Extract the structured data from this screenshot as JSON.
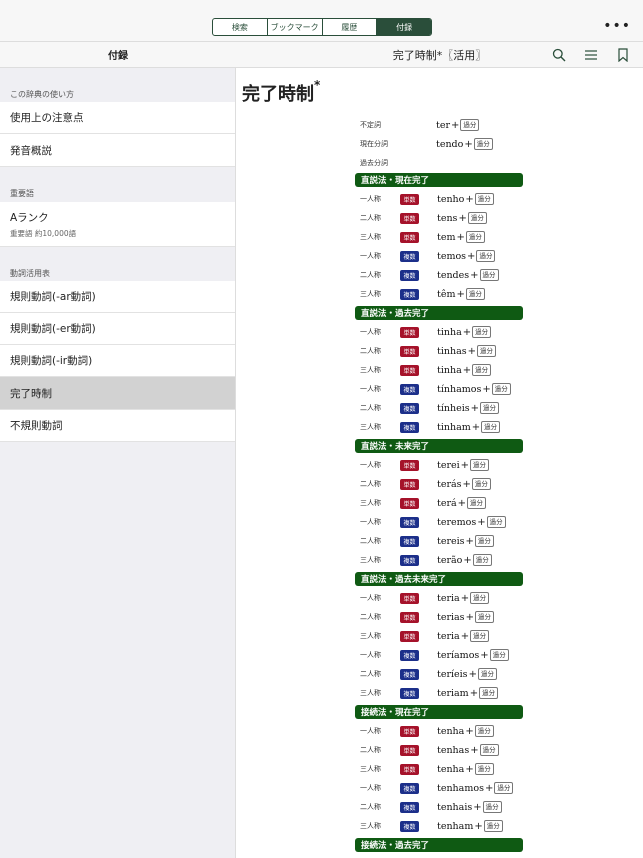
{
  "tabs": [
    {
      "label": "検索"
    },
    {
      "label": "ブックマーク"
    },
    {
      "label": "履歴"
    },
    {
      "label": "付録"
    }
  ],
  "more_label": "•••",
  "sidebar": {
    "title": "付録",
    "sections": [
      {
        "label": "この辞典の使い方",
        "items": [
          {
            "label": "使用上の注意点"
          },
          {
            "label": "発音概説"
          }
        ]
      },
      {
        "label": "重要語",
        "items": [
          {
            "label": "Aランク",
            "sub": "重要語 約10,000語"
          }
        ]
      },
      {
        "label": "動詞活用表",
        "items": [
          {
            "label": "規則動詞(-ar動詞)"
          },
          {
            "label": "規則動詞(-er動詞)"
          },
          {
            "label": "規則動詞(-ir動詞)"
          },
          {
            "label": "完了時制"
          },
          {
            "label": "不規則動詞"
          }
        ]
      }
    ]
  },
  "content": {
    "header_title": "完了時制*〖活用〗",
    "entry_title": "完了時制",
    "entry_mark": "*",
    "pp_tag": "過分",
    "basics": [
      {
        "label": "不定詞",
        "form": "ter"
      },
      {
        "label": "現在分詞",
        "form": "tendo"
      },
      {
        "label": "過去分詞",
        "form": ""
      }
    ],
    "tenses": [
      {
        "name": "直説法・現在完了",
        "rows": [
          {
            "person": "一人称",
            "num": "単数",
            "form": "tenho"
          },
          {
            "person": "二人称",
            "num": "単数",
            "form": "tens"
          },
          {
            "person": "三人称",
            "num": "単数",
            "form": "tem"
          },
          {
            "person": "一人称",
            "num": "複数",
            "form": "temos"
          },
          {
            "person": "二人称",
            "num": "複数",
            "form": "tendes"
          },
          {
            "person": "三人称",
            "num": "複数",
            "form": "têm"
          }
        ]
      },
      {
        "name": "直説法・過去完了",
        "rows": [
          {
            "person": "一人称",
            "num": "単数",
            "form": "tinha"
          },
          {
            "person": "二人称",
            "num": "単数",
            "form": "tinhas"
          },
          {
            "person": "三人称",
            "num": "単数",
            "form": "tinha"
          },
          {
            "person": "一人称",
            "num": "複数",
            "form": "tínhamos"
          },
          {
            "person": "二人称",
            "num": "複数",
            "form": "tínheis"
          },
          {
            "person": "三人称",
            "num": "複数",
            "form": "tinham"
          }
        ]
      },
      {
        "name": "直説法・未来完了",
        "rows": [
          {
            "person": "一人称",
            "num": "単数",
            "form": "terei"
          },
          {
            "person": "二人称",
            "num": "単数",
            "form": "terás"
          },
          {
            "person": "三人称",
            "num": "単数",
            "form": "terá"
          },
          {
            "person": "一人称",
            "num": "複数",
            "form": "teremos"
          },
          {
            "person": "二人称",
            "num": "複数",
            "form": "tereis"
          },
          {
            "person": "三人称",
            "num": "複数",
            "form": "terão"
          }
        ]
      },
      {
        "name": "直説法・過去未来完了",
        "rows": [
          {
            "person": "一人称",
            "num": "単数",
            "form": "teria"
          },
          {
            "person": "二人称",
            "num": "単数",
            "form": "terias"
          },
          {
            "person": "三人称",
            "num": "単数",
            "form": "teria"
          },
          {
            "person": "一人称",
            "num": "複数",
            "form": "teríamos"
          },
          {
            "person": "二人称",
            "num": "複数",
            "form": "teríeis"
          },
          {
            "person": "三人称",
            "num": "複数",
            "form": "teriam"
          }
        ]
      },
      {
        "name": "接続法・現在完了",
        "rows": [
          {
            "person": "一人称",
            "num": "単数",
            "form": "tenha"
          },
          {
            "person": "二人称",
            "num": "単数",
            "form": "tenhas"
          },
          {
            "person": "三人称",
            "num": "単数",
            "form": "tenha"
          },
          {
            "person": "一人称",
            "num": "複数",
            "form": "tenhamos"
          },
          {
            "person": "二人称",
            "num": "複数",
            "form": "tenhais"
          },
          {
            "person": "三人称",
            "num": "複数",
            "form": "tenham"
          }
        ]
      },
      {
        "name": "接続法・過去完了",
        "rows": []
      }
    ]
  },
  "colors": {
    "accent": "#2a4e3a",
    "tense_bar": "#0f5a13",
    "singular": "#a5122a",
    "plural": "#1c2f8a"
  }
}
